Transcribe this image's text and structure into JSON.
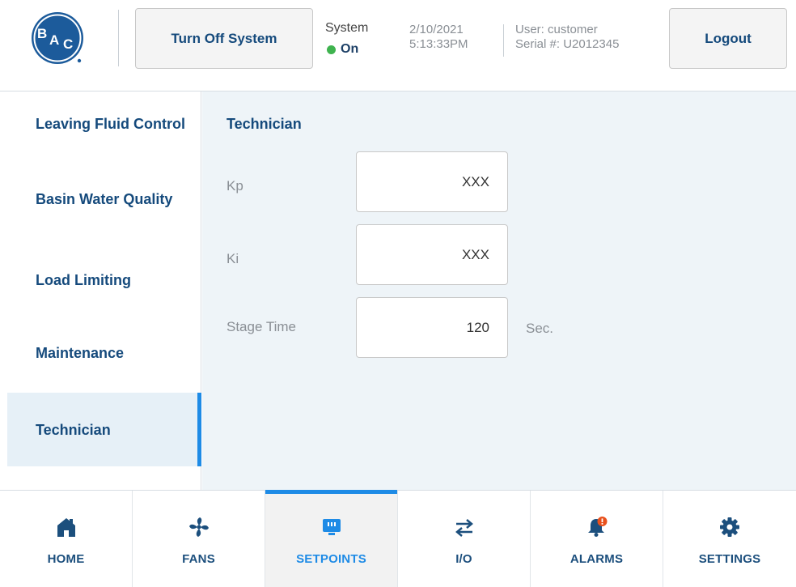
{
  "header": {
    "logo_text": "BAC",
    "turn_off_label": "Turn Off System",
    "system_label": "System",
    "system_status": "On",
    "date": "2/10/2021",
    "time": "5:13:33PM",
    "user": "User: customer",
    "serial": "Serial #: U2012345",
    "logout_label": "Logout"
  },
  "sidebar": {
    "items": [
      {
        "label": "Leaving Fluid Control",
        "active": false
      },
      {
        "label": "Basin Water Quality",
        "active": false
      },
      {
        "label": "Load Limiting",
        "active": false
      },
      {
        "label": "Maintenance",
        "active": false
      },
      {
        "label": "Technician",
        "active": true
      }
    ]
  },
  "main": {
    "title": "Technician",
    "fields": [
      {
        "label": "Kp",
        "value": "XXX",
        "unit": ""
      },
      {
        "label": "Ki",
        "value": "XXX",
        "unit": ""
      },
      {
        "label": "Stage Time",
        "value": "120",
        "unit": "Sec."
      }
    ]
  },
  "nav": {
    "items": [
      {
        "label": "HOME",
        "icon": "home-icon",
        "active": false
      },
      {
        "label": "FANS",
        "icon": "fan-icon",
        "active": false
      },
      {
        "label": "SETPOINTS",
        "icon": "setpoints-icon",
        "active": true
      },
      {
        "label": "I/O",
        "icon": "io-arrows-icon",
        "active": false
      },
      {
        "label": "ALARMS",
        "icon": "alarm-bell-icon",
        "active": false
      },
      {
        "label": "SETTINGS",
        "icon": "gear-icon",
        "active": false
      }
    ]
  },
  "colors": {
    "brand_blue": "#1c5b9b",
    "accent": "#1e8be6",
    "status_on": "#3fb34f",
    "alarm_badge": "#e8501c"
  }
}
